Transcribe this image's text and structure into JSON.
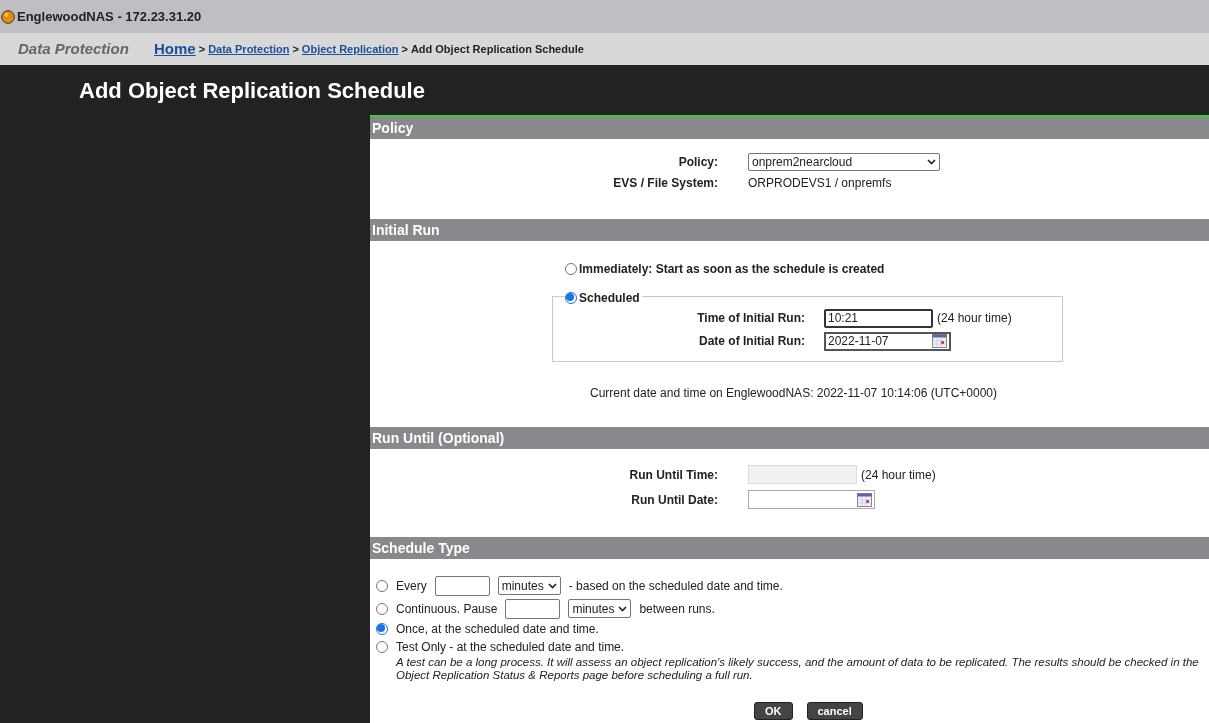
{
  "window": {
    "title": "EnglewoodNAS - 172.23.31.20"
  },
  "breadcrumb": {
    "section": "Data Protection",
    "links": [
      {
        "label": "Home",
        "kind": "home"
      },
      {
        "label": "Data Protection",
        "kind": "link"
      },
      {
        "label": "Object Replication",
        "kind": "link"
      }
    ],
    "current": "Add Object Replication Schedule",
    "separator": ">"
  },
  "page_title": "Add Object Replication Schedule",
  "policy": {
    "header": "Policy",
    "policy_label": "Policy:",
    "policy_value": "onprem2nearcloud",
    "evs_label": "EVS / File System:",
    "evs_value": "ORPRODEVS1 / onpremfs"
  },
  "initial_run": {
    "header": "Initial Run",
    "options": [
      {
        "label": "Immediately: Start as soon as the schedule is created",
        "selected": false
      },
      {
        "label": "Scheduled",
        "selected": true
      }
    ],
    "time_label": "Time of Initial Run:",
    "time_value": "10:21",
    "time_hint": "(24 hour time)",
    "date_label": "Date of Initial Run:",
    "date_value": "2022-11-07",
    "current": "Current date and time on EnglewoodNAS: 2022-11-07 10:14:06 (UTC+0000)"
  },
  "run_until": {
    "header": "Run Until (Optional)",
    "time_label": "Run Until Time:",
    "time_hint": "(24 hour time)",
    "date_label": "Run Until Date:"
  },
  "schedule_type": {
    "header": "Schedule Type",
    "options": [
      {
        "kind": "interval",
        "prefix": "Every",
        "unit": "minutes",
        "suffix": "- based on the scheduled date and time.",
        "selected": false
      },
      {
        "kind": "interval",
        "prefix": "Continuous. Pause",
        "unit": "minutes",
        "suffix": "between runs.",
        "selected": false
      },
      {
        "kind": "plain",
        "label": "Once, at the scheduled date and time.",
        "selected": true
      },
      {
        "kind": "plain",
        "label": "Test Only - at the scheduled date and time.",
        "selected": false,
        "note": "A test can be a long process. It will assess an object replication's likely success, and the amount of data to be replicated. The results should be checked in the Object Replication Status & Reports page before scheduling a full run."
      }
    ]
  },
  "buttons": [
    "OK",
    "cancel"
  ]
}
